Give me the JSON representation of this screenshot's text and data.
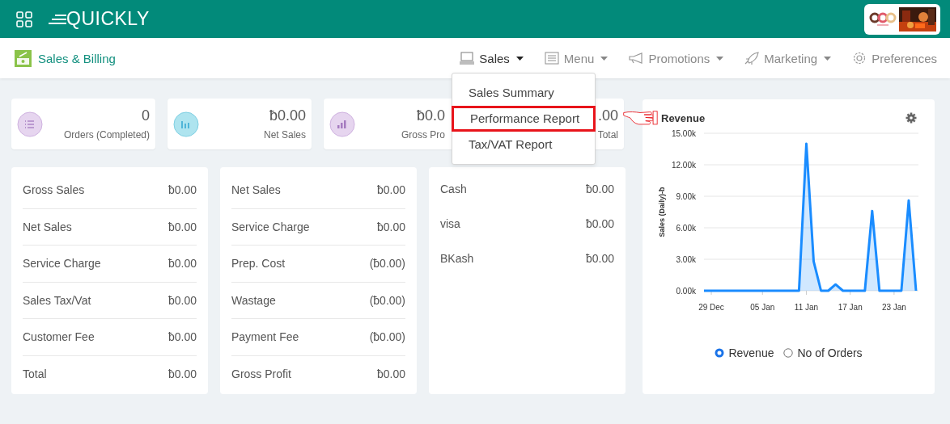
{
  "header": {
    "logo": "QUICKLY"
  },
  "subheader": {
    "title": "Sales & Billing"
  },
  "nav": [
    {
      "label": "Sales",
      "selected": true,
      "dropdown": true
    },
    {
      "label": "Menu",
      "selected": false,
      "dropdown": true
    },
    {
      "label": "Promotions",
      "selected": false,
      "dropdown": true
    },
    {
      "label": "Marketing",
      "selected": false,
      "dropdown": true
    },
    {
      "label": "Preferences",
      "selected": false,
      "dropdown": false
    }
  ],
  "dropdown": {
    "items": [
      {
        "label": "Sales Summary",
        "highlighted": false
      },
      {
        "label": "Performance Report",
        "highlighted": true
      },
      {
        "label": "Tax/VAT Report",
        "highlighted": false
      }
    ]
  },
  "stats": [
    {
      "value": "0",
      "label": "Orders (Completed)",
      "color": "#e6d5ef"
    },
    {
      "value": "ƀ0.00",
      "label": "Net Sales",
      "color": "#aee4ef"
    },
    {
      "value": "ƀ0.0",
      "label": "Gross Pro",
      "color": "#e6d5ef"
    },
    {
      "value": ".00",
      "label": "Total"
    }
  ],
  "columns": [
    {
      "rows": [
        {
          "label": "Gross Sales",
          "value": "ƀ0.00"
        },
        {
          "label": "Net Sales",
          "value": "ƀ0.00"
        },
        {
          "label": "Service Charge",
          "value": "ƀ0.00"
        },
        {
          "label": "Sales Tax/Vat",
          "value": "ƀ0.00"
        },
        {
          "label": "Customer Fee",
          "value": "ƀ0.00"
        },
        {
          "label": "Total",
          "value": "ƀ0.00"
        }
      ]
    },
    {
      "rows": [
        {
          "label": "Net Sales",
          "value": "ƀ0.00"
        },
        {
          "label": "Service Charge",
          "value": "ƀ0.00"
        },
        {
          "label": "Prep. Cost",
          "value": "(ƀ0.00)"
        },
        {
          "label": "Wastage",
          "value": "(ƀ0.00)"
        },
        {
          "label": "Payment Fee",
          "value": "(ƀ0.00)"
        },
        {
          "label": "Gross Profit",
          "value": "ƀ0.00"
        }
      ]
    },
    {
      "rows": [
        {
          "label": "Cash",
          "value": "ƀ0.00"
        },
        {
          "label": "visa",
          "value": "ƀ0.00"
        },
        {
          "label": "BKash",
          "value": "ƀ0.00"
        }
      ]
    }
  ],
  "revenue": {
    "title": "Revenue",
    "chart_data": {
      "type": "area",
      "ylabel": "Sales (Daily)-ƀ",
      "categories": [
        null,
        "29 Dec",
        null,
        null,
        null,
        null,
        null,
        null,
        "05 Jan",
        null,
        null,
        null,
        null,
        null,
        "11 Jan",
        null,
        null,
        null,
        null,
        null,
        "17 Jan",
        null,
        null,
        null,
        null,
        null,
        "23 Jan",
        null,
        null,
        null
      ],
      "series": [
        {
          "color": "#1a8cff",
          "values": [
            0,
            0,
            0,
            0,
            0,
            0,
            0,
            0,
            0,
            0,
            0,
            0,
            0,
            0,
            14000,
            2800,
            0,
            0,
            600,
            0,
            0,
            0,
            0,
            7600,
            0,
            0,
            0,
            0,
            8600,
            0
          ]
        }
      ],
      "ylim": [
        0,
        15000
      ],
      "grid": true,
      "yticks": [
        {
          "value": 0,
          "label": "0.00k"
        },
        {
          "value": 3000,
          "label": "3.00k"
        },
        {
          "value": 6000,
          "label": "6.00k"
        },
        {
          "value": 9000,
          "label": "9.00k"
        },
        {
          "value": 12000,
          "label": "12.00k"
        },
        {
          "value": 15000,
          "label": "15.00k"
        }
      ]
    },
    "options": [
      {
        "label": "Revenue",
        "selected": true
      },
      {
        "label": "No of Orders",
        "selected": false
      }
    ]
  }
}
